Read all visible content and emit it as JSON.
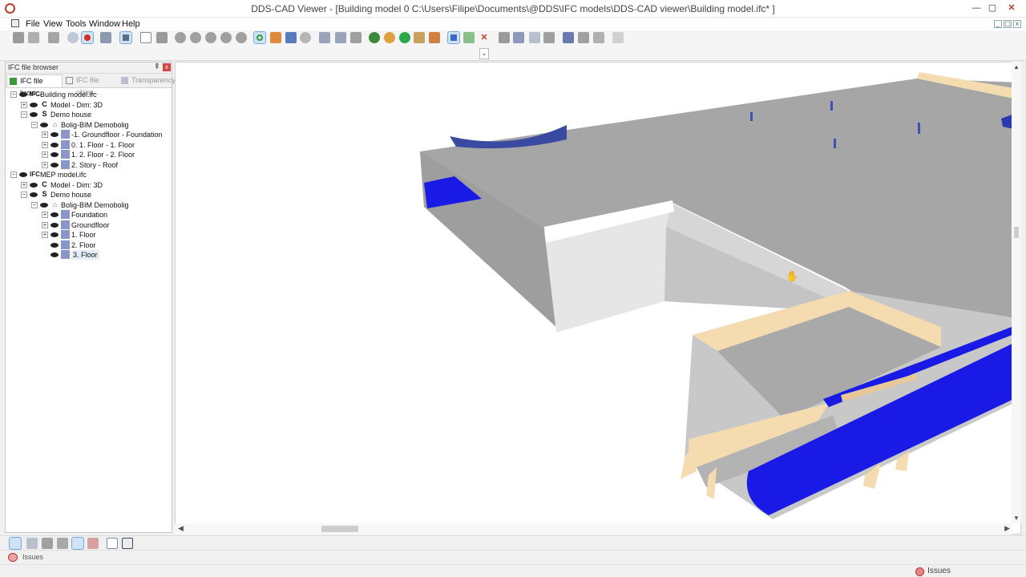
{
  "window": {
    "title": "DDS-CAD Viewer - [Building model  0  C:\\Users\\Filipe\\Documents\\@DDS\\IFC models\\DDS-CAD viewer\\Building model.ifc* ]",
    "minimize_glyph": "—",
    "maximize_glyph": "▢",
    "close_glyph": "✕"
  },
  "menu": {
    "items": [
      "File",
      "View",
      "Tools",
      "Window",
      "Help"
    ],
    "mdi_glyphs": [
      "_",
      "▢",
      "x"
    ]
  },
  "toolbar": {
    "combo_arrow": "⌄"
  },
  "panel": {
    "title": "IFC file browser",
    "pin_glyph": "⇞",
    "close_glyph": "x",
    "tabs": [
      {
        "label": "IFC file brow..."
      },
      {
        "label": "IFC file objec..."
      },
      {
        "label": "Transparency"
      }
    ]
  },
  "tree": [
    {
      "label": "Building model.ifc",
      "icon": "IFC"
    },
    {
      "label": "Model - Dim: 3D",
      "icon": "C"
    },
    {
      "label": "Demo house",
      "icon": "S"
    },
    {
      "label": "Bolig-BIM Demobolig",
      "icon": "B"
    },
    {
      "label": "-1. Groundfloor - Foundation",
      "icon": "L"
    },
    {
      "label": "0. 1. Floor - 1. Floor",
      "icon": "L"
    },
    {
      "label": "1. 2. Floor - 2. Floor",
      "icon": "L"
    },
    {
      "label": "2. Story - Roof",
      "icon": "L"
    },
    {
      "label": "MEP model.ifc",
      "icon": "IFC"
    },
    {
      "label": "Model - Dim: 3D",
      "icon": "C"
    },
    {
      "label": "Demo house",
      "icon": "S"
    },
    {
      "label": "Bolig-BIM Demobolig",
      "icon": "B"
    },
    {
      "label": "Foundation",
      "icon": "L"
    },
    {
      "label": "Groundfloor",
      "icon": "L"
    },
    {
      "label": "1. Floor",
      "icon": "L"
    },
    {
      "label": "2. Floor",
      "icon": "L"
    },
    {
      "label": "3. Floor",
      "icon": "L"
    }
  ],
  "scroll": {
    "left": "◀",
    "right": "▶",
    "up": "▲",
    "down": "▼"
  },
  "issues_tab": {
    "label": "Issues"
  },
  "status": {
    "issues_label": "Issues"
  },
  "colors": {
    "accent_blue": "#1a1ae6",
    "slab_gray": "#a6a6a6",
    "wood": "#f5dcb0",
    "close_red": "#d64541"
  }
}
